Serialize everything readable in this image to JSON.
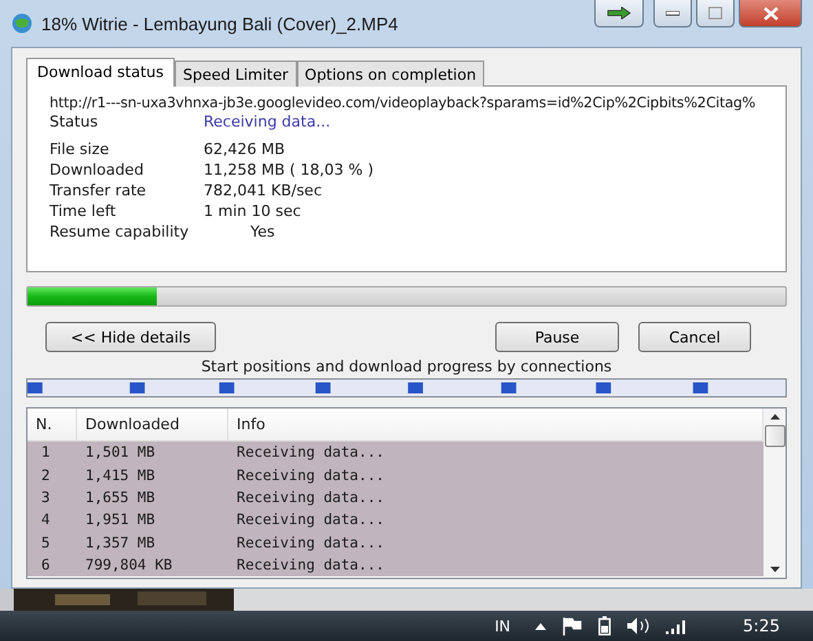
{
  "window": {
    "title": "18% Witrie - Lembayung Bali (Cover)_2.MP4"
  },
  "tabs": [
    {
      "label": "Download status",
      "selected": true
    },
    {
      "label": "Speed Limiter",
      "selected": false
    },
    {
      "label": "Options on completion",
      "selected": false
    }
  ],
  "url": "http://r1---sn-uxa3vhnxa-jb3e.googlevideo.com/videoplayback?sparams=id%2Cip%2Cipbits%2Citag%",
  "status": {
    "label": "Status",
    "value": "Receiving data..."
  },
  "details": [
    {
      "label": "File size",
      "value": "62,426  MB"
    },
    {
      "label": "Downloaded",
      "value": "11,258  MB  ( 18,03 % )"
    },
    {
      "label": "Transfer rate",
      "value": "782,041  KB/sec"
    },
    {
      "label": "Time left",
      "value": "1 min 10 sec"
    },
    {
      "label": "Resume capability",
      "value": "Yes"
    }
  ],
  "progress": {
    "level": 0.17
  },
  "buttons": {
    "hide": "<< Hide details",
    "pause": "Pause",
    "cancel": "Cancel"
  },
  "connections_caption": "Start positions and download progress by connections",
  "table": {
    "columns": [
      "N.",
      "Downloaded",
      "Info"
    ],
    "rows": [
      {
        "n": "1",
        "downloaded": "1,501  MB",
        "info": "Receiving data...",
        "selected": true
      },
      {
        "n": "2",
        "downloaded": "1,415  MB",
        "info": "Receiving data...",
        "selected": true
      },
      {
        "n": "3",
        "downloaded": "1,655  MB",
        "info": "Receiving data...",
        "selected": true
      },
      {
        "n": "4",
        "downloaded": "1,951  MB",
        "info": "Receiving data...",
        "selected": true
      },
      {
        "n": "5",
        "downloaded": "1,357  MB",
        "info": "Receiving data...",
        "selected": true
      },
      {
        "n": "6",
        "downloaded": "799,804  KB",
        "info": "Receiving data...",
        "selected": true
      }
    ]
  },
  "taskbar": {
    "language": "IN",
    "clock": "5:25"
  }
}
